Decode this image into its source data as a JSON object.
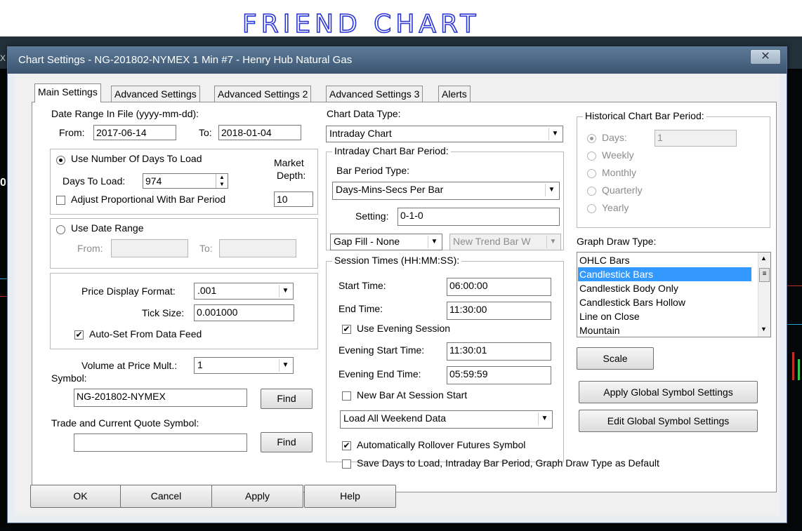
{
  "annotation": {
    "text": "FRIEND CHART"
  },
  "background": {
    "left_glyphs": [
      "X",
      "0"
    ]
  },
  "dialog": {
    "title": "Chart Settings - NG-201802-NYMEX  1 Min   #7 - Henry Hub Natural Gas",
    "close_glyph": "✕",
    "tabs": [
      "Main Settings",
      "Advanced Settings",
      "Advanced Settings 2",
      "Advanced Settings 3",
      "Alerts"
    ],
    "active_tab": "Main Settings"
  },
  "date_range": {
    "header": "Date Range In File (yyyy-mm-dd):",
    "from_label": "From:",
    "from_value": "2017-06-14",
    "to_label": "To:",
    "to_value": "2018-01-04"
  },
  "days_to_load": {
    "radio_label": "Use Number Of Days To Load",
    "selected": true,
    "days_label": "Days To Load:",
    "days_value": "974",
    "market_depth_label_1": "Market",
    "market_depth_label_2": "Depth:",
    "market_depth_value": "10",
    "adjust_label": "Adjust Proportional With Bar Period",
    "adjust_checked": false
  },
  "use_date_range": {
    "radio_label": "Use Date Range",
    "selected": false,
    "from_label": "From:",
    "to_label": "To:"
  },
  "price_format": {
    "label": "Price Display Format:",
    "value": ".001",
    "tick_label": "Tick Size:",
    "tick_value": "0.001000",
    "auto_label": "Auto-Set From Data Feed",
    "auto_checked": true
  },
  "volume": {
    "label": "Volume at Price Mult.:",
    "value": "1"
  },
  "symbol": {
    "label": "Symbol:",
    "value": "NG-201802-NYMEX",
    "find_label": "Find"
  },
  "trade_symbol": {
    "label": "Trade and Current Quote Symbol:",
    "value": "",
    "find_label": "Find"
  },
  "chart_data_type": {
    "label": "Chart Data Type:",
    "value": "Intraday Chart"
  },
  "intraday_period": {
    "group_title": "Intraday Chart Bar Period:",
    "bar_period_type_label": "Bar Period Type:",
    "bar_period_type_value": "Days-Mins-Secs Per Bar",
    "setting_label": "Setting:",
    "setting_value": "0-1-0",
    "gap_fill_value": "Gap Fill - None",
    "new_trend_value": "New Trend Bar W"
  },
  "session": {
    "group_title": "Session Times (HH:MM:SS):",
    "start_label": "Start Time:",
    "start_value": "06:00:00",
    "end_label": "End Time:",
    "end_value": "11:30:00",
    "evening_label": "Use Evening Session",
    "evening_checked": true,
    "evening_start_label": "Evening Start Time:",
    "evening_start_value": "11:30:01",
    "evening_end_label": "Evening End Time:",
    "evening_end_value": "05:59:59",
    "new_bar_label": "New Bar At Session Start",
    "new_bar_checked": false,
    "weekend_value": "Load All Weekend Data"
  },
  "historical": {
    "group_title": "Historical Chart Bar Period:",
    "options": [
      "Days:",
      "Weekly",
      "Monthly",
      "Quarterly",
      "Yearly"
    ],
    "selected": "Days:",
    "days_value": "1"
  },
  "graph_draw": {
    "label": "Graph Draw Type:",
    "items": [
      "OHLC Bars",
      "Candlestick Bars",
      "Candlestick Body Only",
      "Candlestick Bars Hollow",
      "Line on Close",
      "Mountain"
    ],
    "selected": "Candlestick Bars"
  },
  "side_buttons": {
    "scale": "Scale",
    "apply_global": "Apply Global Symbol Settings",
    "edit_global": "Edit Global Symbol Settings"
  },
  "bottom_checks": {
    "rollover_label": "Automatically Rollover Futures Symbol",
    "rollover_checked": true,
    "save_default_label": "Save Days to Load, Intraday Bar Period, Graph Draw Type as Default",
    "save_default_checked": false
  },
  "footer": {
    "ok": "OK",
    "cancel": "Cancel",
    "apply": "Apply",
    "help": "Help"
  },
  "colors": {
    "selection": "#3399ff",
    "title_bar": "#4a6684"
  }
}
